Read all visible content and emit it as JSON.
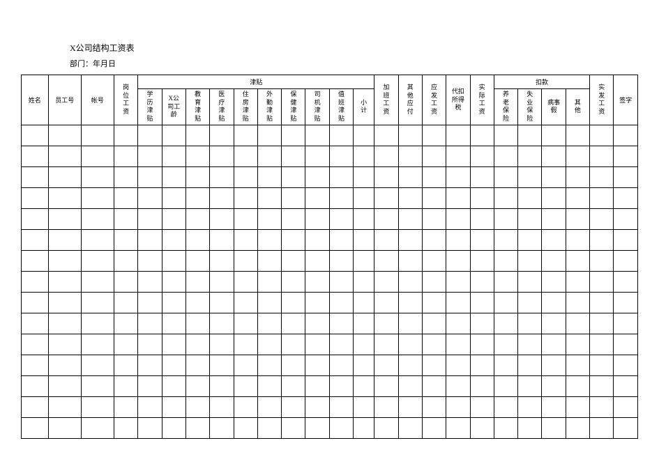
{
  "title": "X公司结构工资表",
  "subtitle": "部门：年月日",
  "headers": {
    "name": "姓名",
    "emp_no": "员工号",
    "account": "帐号",
    "post_salary": "岗位工资",
    "allowance_group": "津贴",
    "allowance": {
      "edu_bg": "学历津贴",
      "seniority": "X公司工龄",
      "edu": "教育津贴",
      "medical": "医疗津贴",
      "housing": "住房津贴",
      "field": "外勤津贴",
      "security": "保健津贴",
      "driver": "司机津贴",
      "duty": "值班津贴",
      "subtotal": "小计"
    },
    "overtime": "加班工资",
    "other_pay": "其他应付",
    "gross": "应发工资",
    "tax": "代扣所得税",
    "net_before_ded": "实际工资",
    "deduction_group": "扣款",
    "deduction": {
      "pension": "养老保险",
      "unemp": "失业保险",
      "sick": "病事假",
      "other": "其他"
    },
    "net_pay": "实发工资",
    "sign": "签字"
  },
  "empty_row_count": 15
}
